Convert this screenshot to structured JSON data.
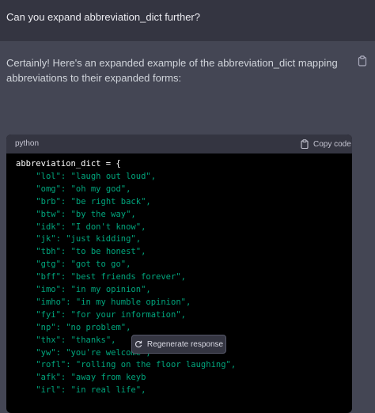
{
  "user_message": {
    "text": "Can you expand abbreviation_dict further?"
  },
  "assistant_message": {
    "intro": "Certainly! Here's an expanded example of the abbreviation_dict mapping abbreviations to their expanded forms:",
    "copy_icon": "clipboard-icon"
  },
  "code_block": {
    "language": "python",
    "copy_label": "Copy code",
    "first_line": "abbreviation_dict = {",
    "entries": [
      {
        "key": "\"lol\":",
        "value": "\"laugh out loud\","
      },
      {
        "key": "\"omg\":",
        "value": "\"oh my god\","
      },
      {
        "key": "\"brb\":",
        "value": "\"be right back\","
      },
      {
        "key": "\"btw\":",
        "value": "\"by the way\","
      },
      {
        "key": "\"idk\":",
        "value": "\"I don't know\","
      },
      {
        "key": "\"jk\":",
        "value": "\"just kidding\","
      },
      {
        "key": "\"tbh\":",
        "value": "\"to be honest\","
      },
      {
        "key": "\"gtg\":",
        "value": "\"got to go\","
      },
      {
        "key": "\"bff\":",
        "value": "\"best friends forever\","
      },
      {
        "key": "\"imo\":",
        "value": "\"in my opinion\","
      },
      {
        "key": "\"imho\":",
        "value": "\"in my humble opinion\","
      },
      {
        "key": "\"fyi\":",
        "value": "\"for your information\","
      },
      {
        "key": "\"np\":",
        "value": "\"no problem\","
      },
      {
        "key": "\"thx\":",
        "value": "\"thanks\","
      },
      {
        "key": "\"yw\":",
        "value": "\"you're welcome\","
      },
      {
        "key": "\"rofl\":",
        "value": "\"rolling on the floor laughing\","
      },
      {
        "key": "\"afk\":",
        "value": "\"away from keyb"
      },
      {
        "key": "\"irl\":",
        "value": "\"in real life\","
      }
    ]
  },
  "regenerate": {
    "label": "Regenerate response",
    "icon": "refresh-icon"
  },
  "colors": {
    "user_bg": "#343541",
    "assistant_bg": "#444654",
    "code_bg": "#000000",
    "string_green": "#00a67d"
  }
}
